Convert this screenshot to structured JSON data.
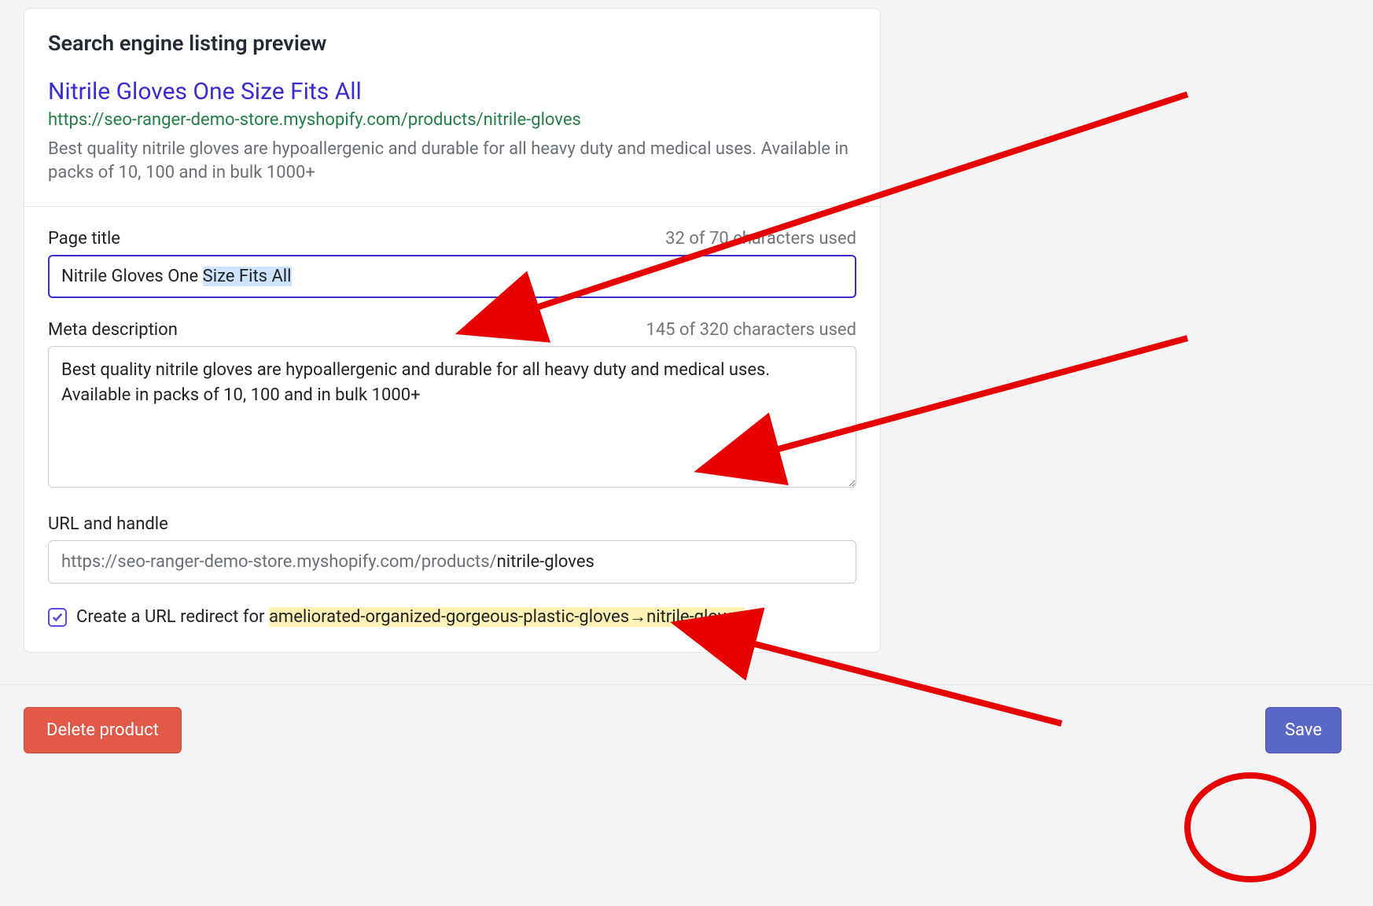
{
  "card": {
    "title": "Search engine listing preview",
    "seo_title": "Nitrile Gloves One Size Fits All",
    "seo_url": "https://seo-ranger-demo-store.myshopify.com/products/nitrile-gloves",
    "seo_desc": "Best quality nitrile gloves are hypoallergenic and durable for all heavy duty and medical uses. Available in packs of 10, 100 and in bulk 1000+"
  },
  "fields": {
    "page_title_label": "Page title",
    "page_title_count": "32 of 70 characters used",
    "page_title_prefix": "Nitrile Gloves One ",
    "page_title_selected": "Size Fits All",
    "meta_label": "Meta description",
    "meta_count": "145 of 320 characters used",
    "meta_value": "Best quality nitrile gloves are hypoallergenic and durable for all heavy duty and medical uses.  Available in packs of 10, 100 and in bulk 1000+",
    "url_label": "URL and handle",
    "url_prefix": "https://seo-ranger-demo-store.myshopify.com/products/ ",
    "url_handle": "nitrile-gloves"
  },
  "redirect": {
    "prefix": "Create a URL redirect for ",
    "old_handle": "ameliorated-organized-gorgeous-plastic-gloves",
    "arrow": "→",
    "new_handle": "nitrile-gloves"
  },
  "footer": {
    "delete_label": "Delete product",
    "save_label": "Save"
  }
}
